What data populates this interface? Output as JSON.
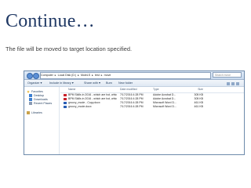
{
  "slide": {
    "title": "Continue…",
    "subtitle": "The file will be moved to target location specified."
  },
  "explorer": {
    "address_segments": [
      "Computer",
      "▸",
      "Local Disk (D:)",
      "▸",
      "MuleLS",
      "▸",
      "test",
      "▸",
      "move"
    ],
    "search_placeholder": "Search move",
    "toolbar": {
      "organize": "Organize ▾",
      "include_in_library": "Include in library ▾",
      "share_with": "Share with ▾",
      "burn": "Burn",
      "new_folder": "New folder"
    },
    "nav": [
      {
        "label": "Favorites",
        "icon": "star-icon",
        "color": "#e8b32a"
      },
      {
        "label": "Desktop",
        "icon": "desktop-icon",
        "color": "#3d7fd0"
      },
      {
        "label": "Downloads",
        "icon": "downloads-icon",
        "color": "#3d7fd0"
      },
      {
        "label": "Recent Places",
        "icon": "recent-places-icon",
        "color": "#8a9bb3"
      },
      {
        "label": "Libraries",
        "icon": "libraries-icon",
        "color": "#c9a24a"
      }
    ],
    "columns": {
      "name": "Name",
      "date": "Date modified",
      "type": "Type",
      "size": "Size"
    },
    "files": [
      {
        "name": "BPM Skills in 2016 - which are hot, which...",
        "date": "7/17/2016 4:28 PM",
        "type": "Adobe Acrobat D...",
        "size": "305 KB",
        "icon": "pdf-icon",
        "color": "#c8232c"
      },
      {
        "name": "BPM Skills in 2016 - which are hot, which...",
        "date": "7/17/2016 4:28 PM",
        "type": "Adobe Acrobat D...",
        "size": "305 KB",
        "icon": "pdf-icon",
        "color": "#c8232c"
      },
      {
        "name": "groovy_mode - Copy.docx",
        "date": "7/17/2016 4:28 PM",
        "type": "Microsoft Word D...",
        "size": "461 KB",
        "icon": "word-doc-icon",
        "color": "#2b5fb4"
      },
      {
        "name": "groovy_mode.docx",
        "date": "7/17/2016 4:28 PM",
        "type": "Microsoft Word D...",
        "size": "461 KB",
        "icon": "word-doc-icon",
        "color": "#2b5fb4"
      }
    ]
  }
}
